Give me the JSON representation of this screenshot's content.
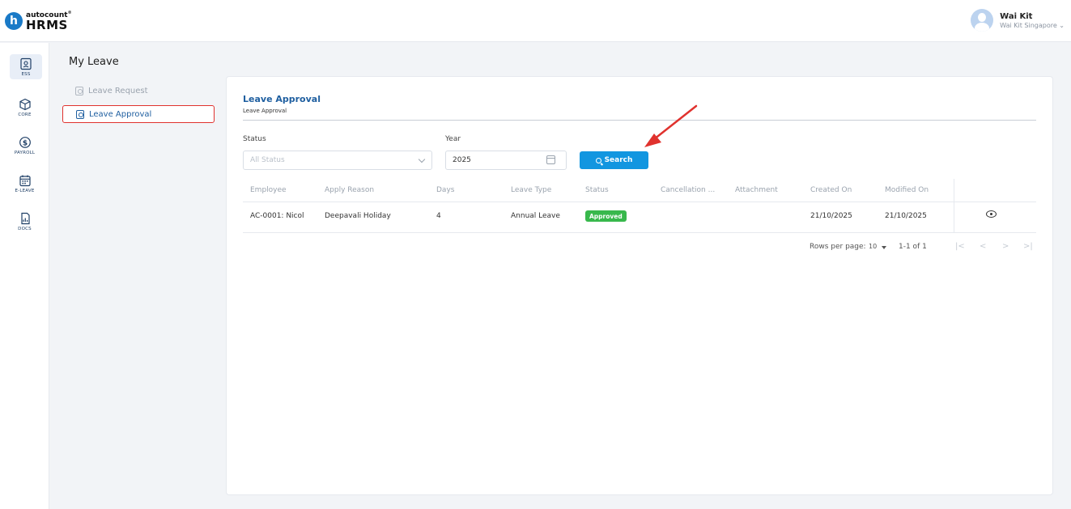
{
  "brand": {
    "top": "autocount",
    "reg": "®",
    "bottom": "HRMS",
    "letter": "h"
  },
  "user": {
    "name": "Wai Kit",
    "company": "Wai Kit Singapore ⌄"
  },
  "nav": [
    {
      "label": "ESS",
      "icon": "ess-icon"
    },
    {
      "label": "CORE",
      "icon": "core-icon"
    },
    {
      "label": "PAYROLL",
      "icon": "payroll-icon"
    },
    {
      "label": "E-LEAVE",
      "icon": "calendar-icon"
    },
    {
      "label": "DOCS",
      "icon": "docs-icon"
    }
  ],
  "page_title": "My Leave",
  "subnav": [
    {
      "label": "Leave Request"
    },
    {
      "label": "Leave Approval"
    }
  ],
  "card": {
    "title": "Leave Approval",
    "subtitle": "Leave Approval"
  },
  "filters": {
    "status_label": "Status",
    "status_placeholder": "All Status",
    "year_label": "Year",
    "year_value": "2025",
    "search_label": "Search"
  },
  "table": {
    "headers": [
      "Employee",
      "Apply Reason",
      "Days",
      "Leave Type",
      "Status",
      "Cancellation ...",
      "Attachment",
      "Created On",
      "Modified On"
    ],
    "rows": [
      {
        "employee": "AC-0001: Nicol",
        "reason": "Deepavali Holiday",
        "days": "4",
        "leave_type": "Annual Leave",
        "status": "Approved",
        "cancellation": "",
        "attachment": "",
        "created_on": "21/10/2025",
        "modified_on": "21/10/2025"
      }
    ]
  },
  "pagination": {
    "rows_label": "Rows per page:",
    "rows_value": "10",
    "range": "1-1 of 1",
    "first": "|<",
    "prev": "<",
    "next": ">",
    "last": ">|"
  },
  "colors": {
    "accent": "#1296e0",
    "title": "#1f5fa0",
    "approved": "#38b84c",
    "highlight": "#e0322e"
  }
}
